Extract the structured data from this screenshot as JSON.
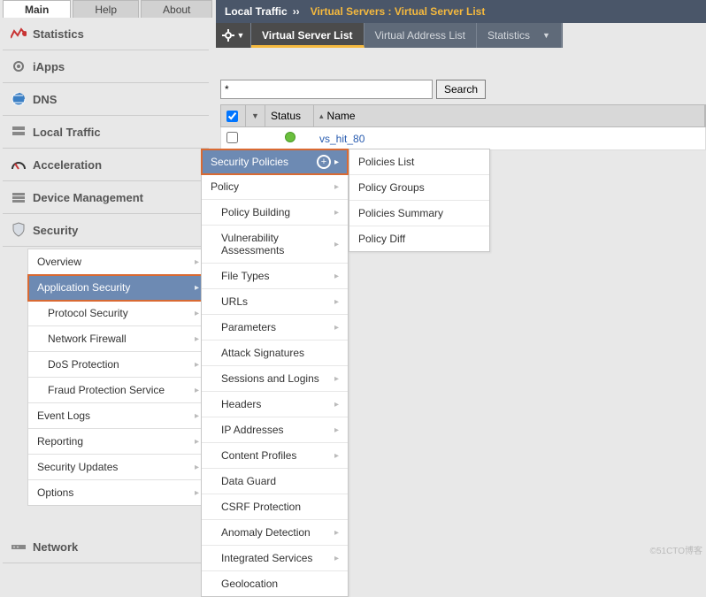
{
  "tabs": {
    "main": "Main",
    "help": "Help",
    "about": "About"
  },
  "breadcrumb": {
    "root": "Local Traffic",
    "sep": "››",
    "rest": "Virtual Servers : Virtual Server List"
  },
  "subtabs": {
    "t1": "Virtual Server List",
    "t2": "Virtual Address List",
    "t3": "Statistics"
  },
  "side": {
    "statistics": "Statistics",
    "iapps": "iApps",
    "dns": "DNS",
    "local": "Local Traffic",
    "accel": "Acceleration",
    "devmgmt": "Device Management",
    "security": "Security",
    "network": "Network"
  },
  "secmenu": {
    "overview": "Overview",
    "appsec": "Application Security",
    "protsec": "Protocol Security",
    "netfw": "Network Firewall",
    "dos": "DoS Protection",
    "fraud": "Fraud Protection Service",
    "evlog": "Event Logs",
    "report": "Reporting",
    "secupd": "Security Updates",
    "options": "Options"
  },
  "search": {
    "value": "*",
    "btn": "Search"
  },
  "grid": {
    "status": "Status",
    "name": "Name",
    "row0": {
      "name": "vs_hit_80"
    }
  },
  "fly1": {
    "header": "Security Policies",
    "policy": "Policy",
    "polbuild": "Policy Building",
    "vuln": "Vulnerability Assessments",
    "ftypes": "File Types",
    "urls": "URLs",
    "params": "Parameters",
    "atksig": "Attack Signatures",
    "sess": "Sessions and Logins",
    "headers": "Headers",
    "ipaddr": "IP Addresses",
    "cprof": "Content Profiles",
    "dataguard": "Data Guard",
    "csrf": "CSRF Protection",
    "anom": "Anomaly Detection",
    "intsvc": "Integrated Services",
    "geo": "Geolocation"
  },
  "fly2": {
    "plist": "Policies List",
    "pgroups": "Policy Groups",
    "psumm": "Policies Summary",
    "pdiff": "Policy Diff"
  },
  "water": "©51CTO博客"
}
